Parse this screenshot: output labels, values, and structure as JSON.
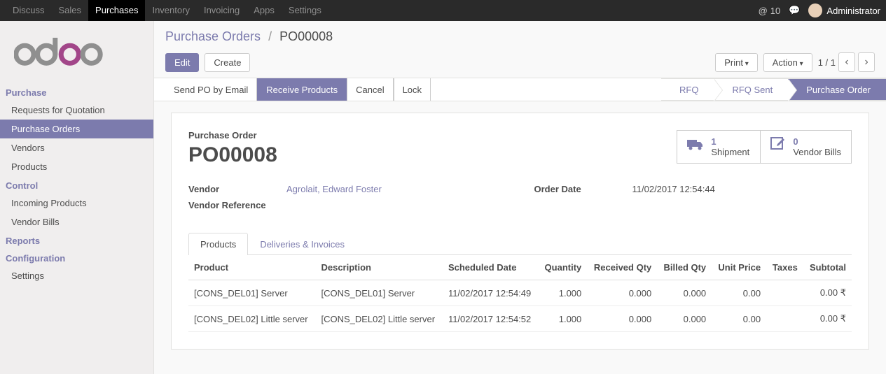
{
  "topnav": {
    "items": [
      "Discuss",
      "Sales",
      "Purchases",
      "Inventory",
      "Invoicing",
      "Apps",
      "Settings"
    ],
    "active_index": 2,
    "msg_count": "10",
    "username": "Administrator"
  },
  "sidebar": {
    "groups": [
      {
        "header": "Purchase",
        "items": [
          "Requests for Quotation",
          "Purchase Orders",
          "Vendors",
          "Products"
        ],
        "active_index": 1
      },
      {
        "header": "Control",
        "items": [
          "Incoming Products",
          "Vendor Bills"
        ],
        "active_index": -1
      },
      {
        "header": "Reports",
        "items": [],
        "active_index": -1
      },
      {
        "header": "Configuration",
        "items": [
          "Settings"
        ],
        "active_index": -1
      }
    ]
  },
  "breadcrumb": {
    "parent": "Purchase Orders",
    "current": "PO00008"
  },
  "buttons": {
    "edit": "Edit",
    "create": "Create",
    "print": "Print",
    "action": "Action",
    "send_po": "Send PO by Email",
    "receive": "Receive Products",
    "cancel": "Cancel",
    "lock": "Lock"
  },
  "pager": {
    "text": "1 / 1"
  },
  "status_steps": {
    "items": [
      "RFQ",
      "RFQ Sent",
      "Purchase Order"
    ],
    "active_index": 2
  },
  "record": {
    "type_label": "Purchase Order",
    "name": "PO00008",
    "stats": {
      "shipment_count": "1",
      "shipment_label": "Shipment",
      "bills_count": "0",
      "bills_label": "Vendor Bills"
    },
    "fields": {
      "vendor_label": "Vendor",
      "vendor_value": "Agrolait, Edward Foster",
      "vendor_ref_label": "Vendor Reference",
      "vendor_ref_value": "",
      "order_date_label": "Order Date",
      "order_date_value": "11/02/2017 12:54:44"
    }
  },
  "tabs": {
    "items": [
      "Products",
      "Deliveries & Invoices"
    ],
    "active_index": 0
  },
  "table": {
    "headers": [
      "Product",
      "Description",
      "Scheduled Date",
      "Quantity",
      "Received Qty",
      "Billed Qty",
      "Unit Price",
      "Taxes",
      "Subtotal"
    ],
    "rows": [
      {
        "product": "[CONS_DEL01] Server",
        "desc": "[CONS_DEL01] Server",
        "date": "11/02/2017 12:54:49",
        "qty": "1.000",
        "recv": "0.000",
        "billed": "0.000",
        "price": "0.00",
        "taxes": "",
        "subtotal": "0.00 ₹"
      },
      {
        "product": "[CONS_DEL02] Little server",
        "desc": "[CONS_DEL02] Little server",
        "date": "11/02/2017 12:54:52",
        "qty": "1.000",
        "recv": "0.000",
        "billed": "0.000",
        "price": "0.00",
        "taxes": "",
        "subtotal": "0.00 ₹"
      }
    ]
  }
}
